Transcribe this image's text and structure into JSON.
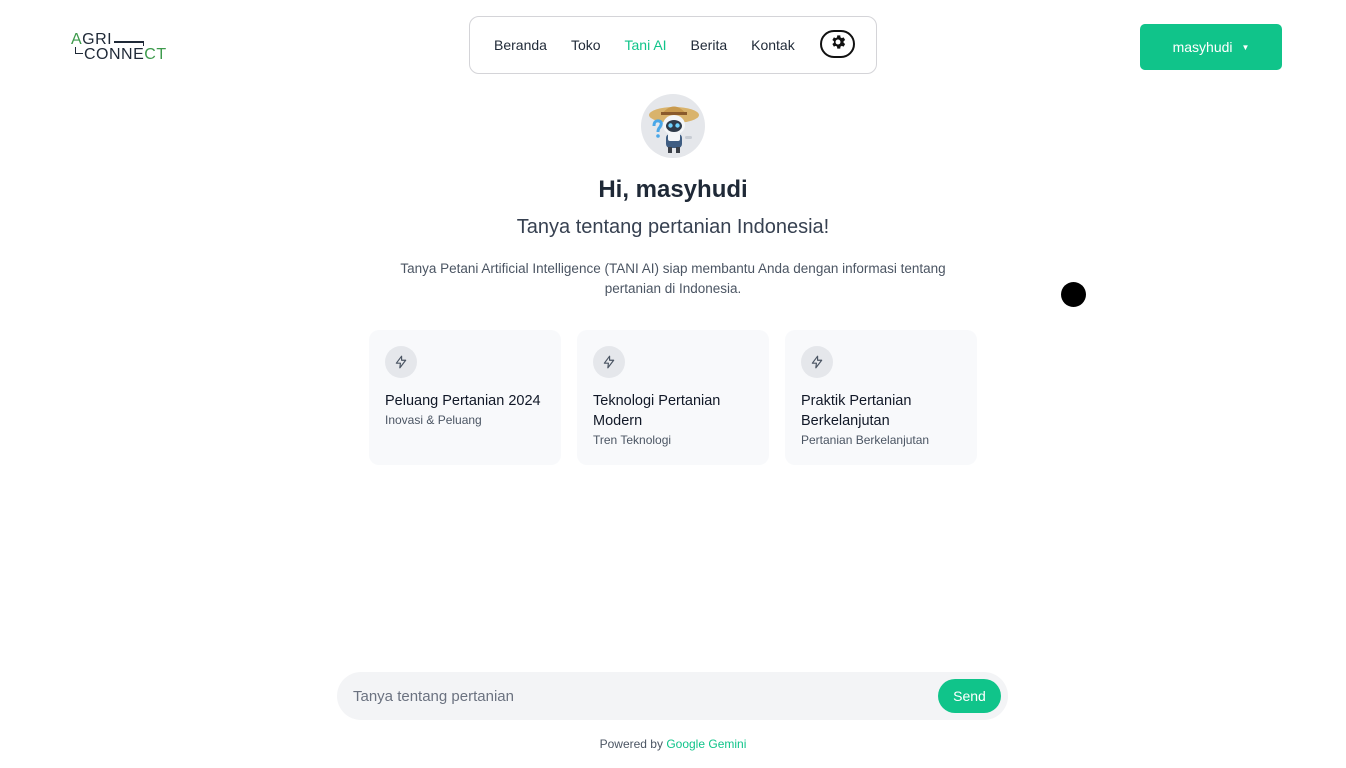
{
  "logo": {
    "line1_first": "A",
    "line1_rest": "GRI",
    "line2_main": "CONNE",
    "line2_accent": "CT"
  },
  "nav": {
    "items": [
      {
        "label": "Beranda",
        "active": false
      },
      {
        "label": "Toko",
        "active": false
      },
      {
        "label": "Tani AI",
        "active": true
      },
      {
        "label": "Berita",
        "active": false
      },
      {
        "label": "Kontak",
        "active": false
      }
    ],
    "theme_icon": "gear-icon"
  },
  "user": {
    "name": "masyhudi",
    "caret": "▼"
  },
  "hero": {
    "greeting": "Hi, masyhudi",
    "subtitle": "Tanya tentang pertanian Indonesia!",
    "description": "Tanya Petani Artificial Intelligence (TANI AI) siap membantu Anda dengan informasi tentang pertanian di Indonesia."
  },
  "suggestions": [
    {
      "title": "Peluang Pertanian 2024",
      "subtitle": "Inovasi & Peluang",
      "icon": "lightning-icon"
    },
    {
      "title": "Teknologi Pertanian Modern",
      "subtitle": "Tren Teknologi",
      "icon": "lightning-icon"
    },
    {
      "title": "Praktik Pertanian Berkelanjutan",
      "subtitle": "Pertanian Berkelanjutan",
      "icon": "lightning-icon"
    }
  ],
  "chat": {
    "placeholder": "Tanya tentang pertanian",
    "value": "",
    "send_label": "Send"
  },
  "footer": {
    "powered_prefix": "Powered by",
    "powered_brand": "Google Gemini"
  },
  "colors": {
    "accent": "#10c48a",
    "logo_green": "#3d9a4c",
    "card_bg": "#f8f9fb"
  }
}
